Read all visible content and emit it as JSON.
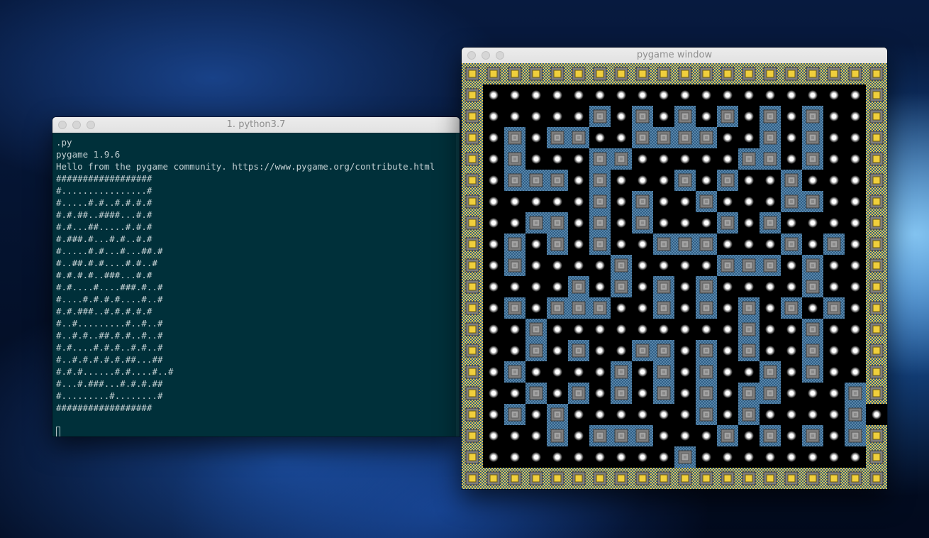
{
  "terminal": {
    "title": "1. python3.7",
    "lines": [
      ".py",
      "pygame 1.9.6",
      "Hello from the pygame community. https://www.pygame.org/contribute.html",
      "##################",
      "#................#",
      "#.....#.#..#.#.#.#",
      "#.#.##..####...#.#",
      "#.#...##.....#.#.#",
      "#.###.#...#.#..#.#",
      "#.....#.#...#...##.#",
      "#..##.#.#....#.#..#",
      "#.#.#.#..###...#.#",
      "#.#....#....###.#..#",
      "#....#.#.#.#....#..#",
      "#.#.###..#.#.#.#.#",
      "#..#.........#..#..#",
      "#..#.#..##.#.#..#..#",
      "#.#....#.#.#..#.#..#",
      "#..#.#.#.#.#.##...##",
      "#.#.#......#.#....#..#",
      "#...#.###...#.#.#.##",
      "#.........#........#",
      "##################"
    ]
  },
  "game": {
    "title": "pygame window",
    "grid": [
      "####################",
      "#..................#",
      "#.....#.#.#.#.#.#..#",
      "#.#.##..####..#.#..#",
      "#.#...##.....##.#..#",
      "#.###.#...#.#..#...#",
      "#.....#.#..#...##..#",
      "#..##.#.#...#.#....#",
      "#.#.#.#..###...#.#.#",
      "#.#....#....###.#..#",
      "#....#.#.#.#....#..#",
      "#.#.###..#.#.#.#.#.#",
      "#..#.........#..#..#",
      "#..#.#..##.#.#..#..#",
      "#.#....#.#.#..#.#..#",
      "#..#.#.#.#.#.##...##",
      "#.#.#......#.#....#.#",
      "#...#.###...#.#.#.##",
      "#.........#........#",
      "####################"
    ]
  }
}
